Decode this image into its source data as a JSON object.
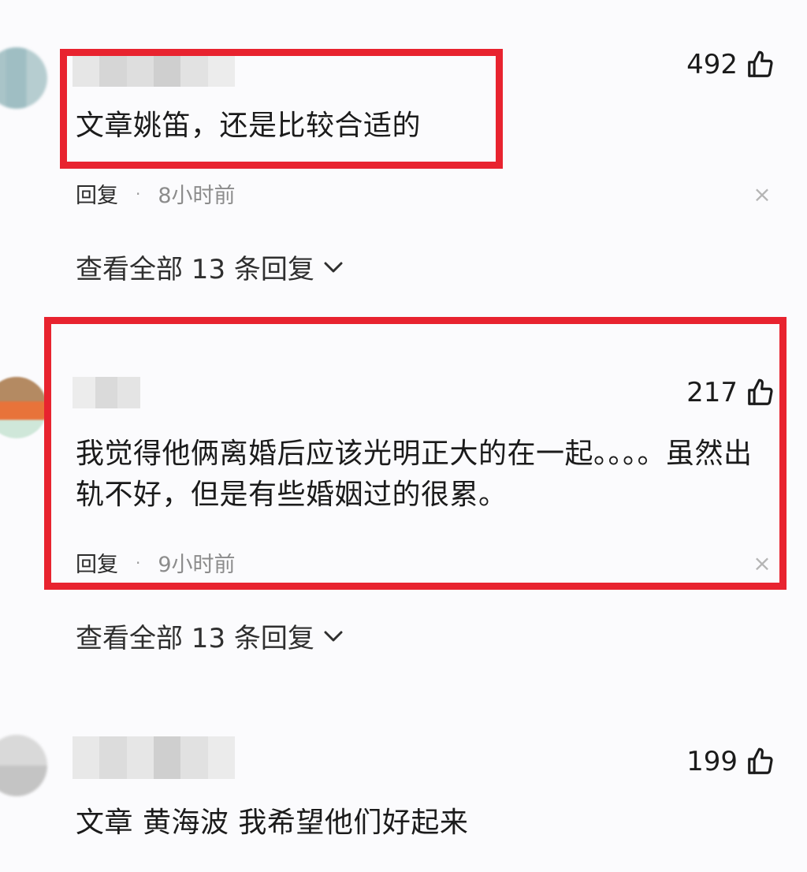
{
  "comments": [
    {
      "text": "文章姚笛，还是比较合适的",
      "likes": "492",
      "reply_label": "回复",
      "separator": "·",
      "time": "8小时前",
      "close_glyph": "×",
      "view_all": "查看全部 13 条回复"
    },
    {
      "text": "我觉得他俩离婚后应该光明正大的在一起。。。。虽然出轨不好，但是有些婚姻过的很累。",
      "likes": "217",
      "reply_label": "回复",
      "separator": "·",
      "time": "9小时前",
      "close_glyph": "×",
      "view_all": "查看全部 13 条回复"
    },
    {
      "text": "文章 黄海波 我希望他们好起来",
      "likes": "199"
    }
  ],
  "colors": {
    "highlight_border": "#e8232f",
    "background": "#fbfbfd",
    "muted_text": "#8c8c8c"
  },
  "icons": {
    "like": "thumbs-up-icon",
    "expand": "chevron-down-icon",
    "dismiss": "close-icon"
  }
}
